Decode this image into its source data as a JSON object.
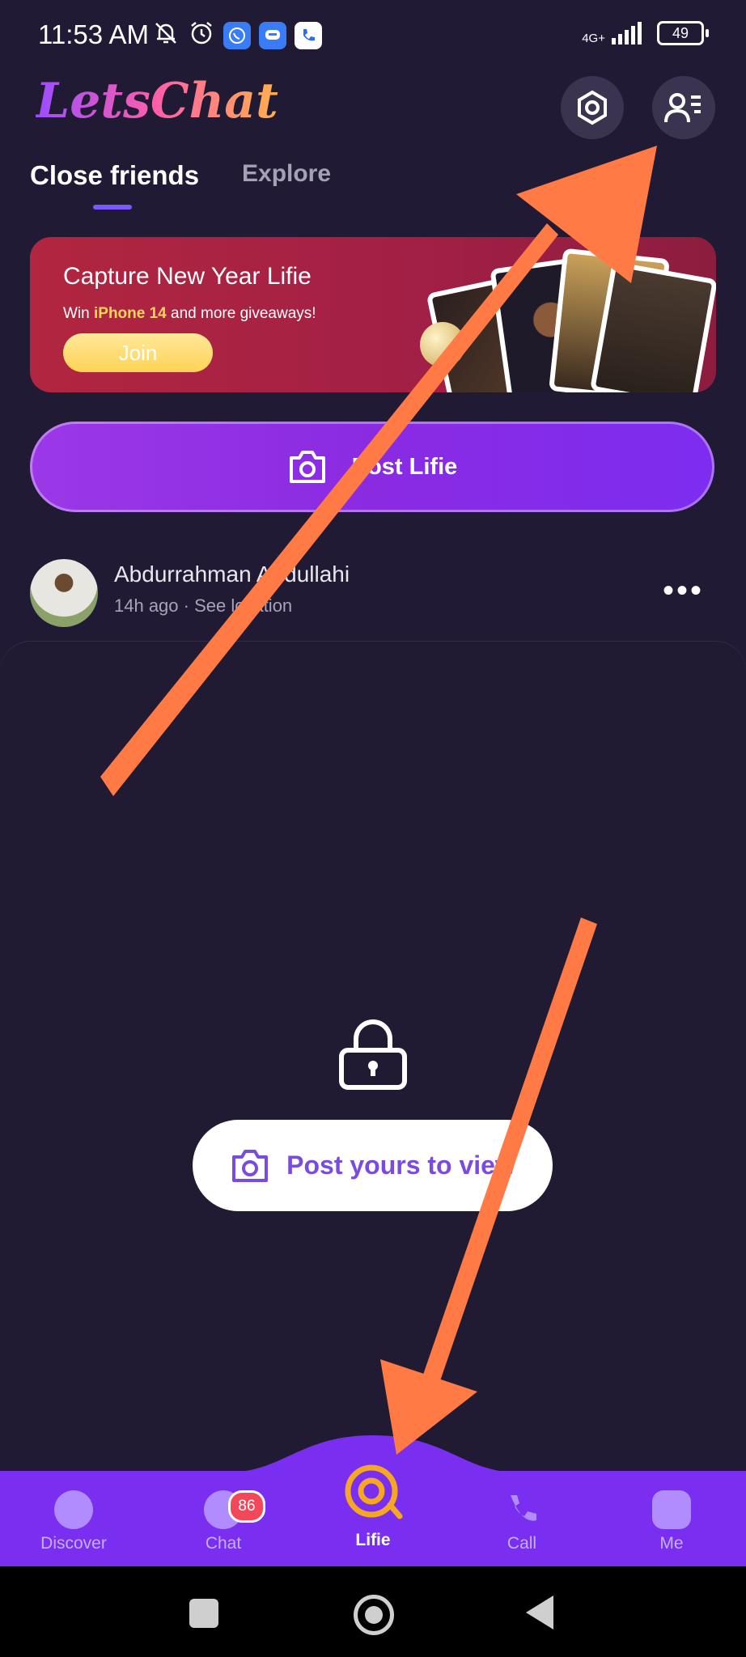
{
  "status_bar": {
    "time": "11:53 AM",
    "network": "4G+",
    "battery": "49"
  },
  "header": {
    "logo": "LetsChat",
    "settings_icon": "hexagon-settings-icon",
    "profile_icon": "profile-list-icon"
  },
  "tabs": [
    {
      "label": "Close friends",
      "active": true
    },
    {
      "label": "Explore",
      "active": false
    }
  ],
  "banner": {
    "title": "Capture New Year Lifie",
    "subtitle_prefix": "Win ",
    "subtitle_highlight": "iPhone 14",
    "subtitle_suffix": " and more giveaways!",
    "join_label": "Join"
  },
  "post_button": {
    "label": "Post Lifie"
  },
  "friend": {
    "name": "Abdurrahman Abdullahi",
    "meta": "14h ago · See location"
  },
  "locked": {
    "view_label": "Post yours to view"
  },
  "bottom_nav": {
    "items": [
      {
        "label": "Discover",
        "icon": "discover-icon"
      },
      {
        "label": "Chat",
        "icon": "chat-icon",
        "badge": "86"
      },
      {
        "label": "Lifie",
        "icon": "lifie-icon",
        "active": true
      },
      {
        "label": "Call",
        "icon": "phone-icon"
      },
      {
        "label": "Me",
        "icon": "me-icon"
      }
    ]
  },
  "colors": {
    "background": "#211a34",
    "accent": "#7a2ff0",
    "banner": "#b12640",
    "annotation_arrow": "#ff7a45"
  }
}
